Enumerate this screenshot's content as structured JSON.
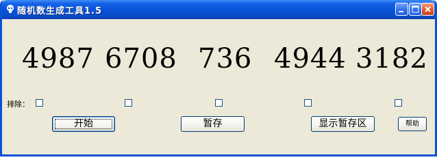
{
  "window": {
    "title": "随机数生成工具1.5",
    "title_color": "#0853d8",
    "background": "#ece9d8"
  },
  "title_buttons": [
    "minimize-icon",
    "maximize-icon",
    "close-icon"
  ],
  "numbers": [
    "4987",
    "6708",
    "736",
    "4944",
    "3182"
  ],
  "exclude": {
    "label": "排除：",
    "checkboxes": [
      false,
      false,
      false,
      false,
      false
    ]
  },
  "buttons": {
    "start": "开始",
    "store": "暂存",
    "show_store": "显示暂存区",
    "help": "帮助"
  }
}
